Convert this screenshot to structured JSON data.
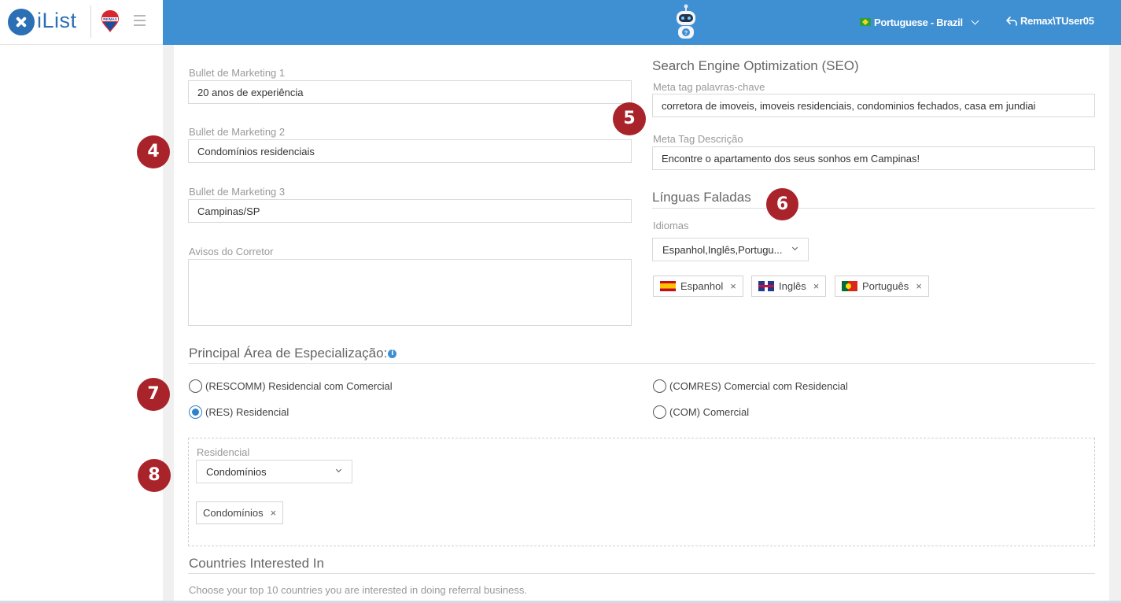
{
  "header": {
    "brand_name": "iList",
    "language": "Portuguese - Brazil",
    "user": "Remax\\TUser05",
    "icons": [
      "ilist-logo-icon",
      "remax-balloon-icon",
      "hamburger-icon",
      "robot-icon",
      "brazil-flag-icon",
      "chevron-down-icon",
      "return-arrow-icon"
    ]
  },
  "marketing": {
    "bullet1_label": "Bullet de Marketing 1",
    "bullet1_value": "20 anos de experiência",
    "bullet2_label": "Bullet de Marketing 2",
    "bullet2_value": "Condomínios residenciais",
    "bullet3_label": "Bullet de Marketing 3",
    "bullet3_value": "Campinas/SP",
    "notices_label": "Avisos do Corretor",
    "notices_value": ""
  },
  "seo": {
    "title": "Search Engine Optimization (SEO)",
    "keywords_label": "Meta tag palavras-chave",
    "keywords_value": "corretora de imoveis, imoveis residenciais, condominios fechados, casa em jundiai",
    "description_label": "Meta Tag Descrição",
    "description_value": "Encontre o apartamento dos seus sonhos em Campinas!"
  },
  "languages": {
    "title": "Línguas Faladas",
    "field_label": "Idiomas",
    "select_value": "Espanhol,Inglês,Portugu...",
    "tags": [
      {
        "label": "Espanhol",
        "flag": "spain-flag-icon"
      },
      {
        "label": "Inglês",
        "flag": "uk-flag-icon"
      },
      {
        "label": "Português",
        "flag": "portugal-flag-icon"
      }
    ],
    "remove_symbol": "×"
  },
  "specialization": {
    "title": "Principal Área de Especialização:",
    "info_symbol": "i",
    "options": [
      {
        "label": "(RESCOMM) Residencial com Comercial",
        "checked": false
      },
      {
        "label": "(COMRES) Comercial com Residencial",
        "checked": false
      },
      {
        "label": "(RES) Residencial",
        "checked": true
      },
      {
        "label": "(COM) Comercial",
        "checked": false
      }
    ],
    "residencial_label": "Residencial",
    "residencial_select": "Condomínios",
    "residencial_tag": "Condomínios"
  },
  "countries": {
    "title": "Countries Interested In",
    "helper": "Choose your top 10 countries you are interested in doing referral business."
  },
  "badges": [
    "4",
    "5",
    "6",
    "7",
    "8"
  ],
  "colors": {
    "topbar": "#3f8fd3",
    "badge": "#a9232b",
    "radio_checked": "#2f80c9"
  }
}
